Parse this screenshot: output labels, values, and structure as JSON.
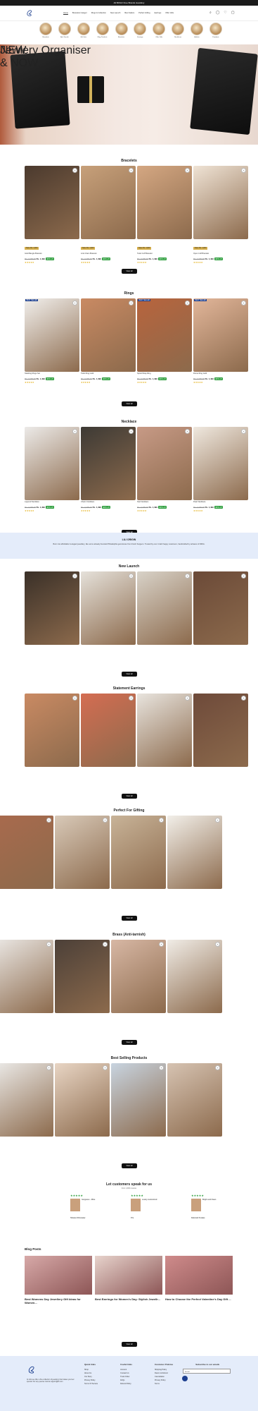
{
  "topbar": {
    "text": "All BOGO Free Brands Jewellery"
  },
  "nav": [
    "Home",
    "Bracelets Categor",
    "Rings & Collection",
    "New Launch",
    "Best Sellers",
    "Perfect Gifting",
    "Earrings",
    "Offer Gifts",
    "Brass (Anti-tarnish)"
  ],
  "header_icons": [
    "search-icon",
    "user-icon",
    "heart-icon",
    "cart-icon"
  ],
  "categories": [
    "Bracelets",
    "Anti-Tarnish",
    "Gift-Sets",
    "Ring Products",
    "Bracelets",
    "Earrings",
    "Offer Gifts",
    "Necklaces",
    "Anklets",
    "Pendants"
  ],
  "hero": {
    "line1": "NEW",
    "line2": "& NOW",
    "sub": "Jewlery Organiser"
  },
  "sections": [
    {
      "title": "Bracelets",
      "products": [
        {
          "save": "Save Rs. 1,000",
          "name": "Gold Bangle Bracelet",
          "mrp": "Rs. 2,499.00",
          "price": "Rs. 1,499",
          "off": "40% off",
          "badge": ""
        },
        {
          "save": "Save Rs. 1,000",
          "name": "Link Chain Bracelet",
          "mrp": "Rs. 2,499.00",
          "price": "Rs. 1,499",
          "off": "40% off",
          "badge": ""
        },
        {
          "save": "Save Rs. 1,000",
          "name": "Twist Cuff Bracelet",
          "mrp": "Rs. 2,499.00",
          "price": "Rs. 1,499",
          "off": "40% off",
          "badge": ""
        },
        {
          "save": "Save Rs. 1,000",
          "name": "Open Cuff Bracelet",
          "mrp": "Rs. 2,499.00",
          "price": "Rs. 1,499",
          "off": "40% off",
          "badge": ""
        }
      ]
    },
    {
      "title": "Rings",
      "products": [
        {
          "save": "",
          "name": "Stacking Rings Set",
          "mrp": "Rs. 2,499.00",
          "price": "Rs. 1,499",
          "off": "40% off",
          "badge": "BEST SELLER"
        },
        {
          "save": "",
          "name": "Twist Ring Gold",
          "mrp": "Rs. 2,499.00",
          "price": "Rs. 1,499",
          "off": "40% off",
          "badge": ""
        },
        {
          "save": "",
          "name": "Spiral Wrap Ring",
          "mrp": "Rs. 2,499.00",
          "price": "Rs. 1,499",
          "off": "40% off",
          "badge": "BEST SELLER"
        },
        {
          "save": "",
          "name": "Dome Ring Gold",
          "mrp": "Rs. 2,499.00",
          "price": "Rs. 1,499",
          "off": "40% off",
          "badge": "BEST SELLER"
        }
      ]
    },
    {
      "title": "Necklace",
      "products": [
        {
          "save": "",
          "name": "Layered Necklace",
          "mrp": "Rs. 2,499.00",
          "price": "Rs. 1,499",
          "off": "40% off",
          "badge": ""
        },
        {
          "save": "",
          "name": "Charm Necklace",
          "mrp": "Rs. 2,499.00",
          "price": "Rs. 1,499",
          "off": "40% off",
          "badge": ""
        },
        {
          "save": "",
          "name": "Star Necklace",
          "mrp": "Rs. 2,499.00",
          "price": "Rs. 1,499",
          "off": "40% off",
          "badge": ""
        },
        {
          "save": "",
          "name": "Pearl Necklace",
          "mrp": "Rs. 2,499.00",
          "price": "Rs. 1,499",
          "off": "40% off",
          "badge": ""
        }
      ]
    }
  ],
  "origin": {
    "title": "LILI ORIGIN",
    "desc": "Born into affordable & elegant jewellery, like we've already founded Philadelphia gemstones from Fresh Surgeon. Trusted by over 1 lakh happy customers, handcrafted by artisans of INDIA."
  },
  "sections2": [
    {
      "title": "New Launch"
    },
    {
      "title": "Statement Earrings"
    },
    {
      "title": "Perfect For Gifting"
    },
    {
      "title": "Brass (Anti-tarnish)"
    },
    {
      "title": "Best Selling Products"
    }
  ],
  "reviews": {
    "title": "Let customers speak for us",
    "sub": "from 1,000 reviews",
    "items": [
      {
        "stars": "★★★★★",
        "title": "Gorgeous - Mine",
        "name": "Shweta Shrivastav"
      },
      {
        "stars": "★★★★★",
        "title": "Lovely customized",
        "name": "P.G."
      },
      {
        "stars": "★★★★★",
        "title": "Bright and Clean",
        "name": "Deborah Perales"
      }
    ]
  },
  "blog": {
    "title": "Blog Posts",
    "posts": [
      {
        "title": "Best Womens Day Jewellery Gift Ideas for Women..."
      },
      {
        "title": "Best Earrings for Women's Day: Stylish Jewellr..."
      },
      {
        "title": "How to Choose the Perfect Valentine's Day Gift ..."
      }
    ]
  },
  "view_all": "View all",
  "footer": {
    "cols": [
      {
        "h": "Quick links",
        "items": [
          "Shop",
          "About Us",
          "Our Story",
          "Privacy Policy",
          "Terms Of Service"
        ]
      },
      {
        "h": "Useful links",
        "items": [
          "Account",
          "Contact Us",
          "Track Order",
          "FAQs",
          "Refund Policy"
        ]
      },
      {
        "h": "Customer Policies",
        "items": [
          "Shipping Policy",
          "Return & Refund",
          "Cancellation",
          "Privacy Policy",
          "Terms"
        ]
      },
      {
        "h": "Subscribe to our emails",
        "items": []
      }
    ],
    "email_placeholder": "Email",
    "about": "At Lilis we offer a fine collection of jewellery that makes you feel special. For any queries mail at support@lili.com"
  },
  "colors": {
    "accent": "#d7b04d",
    "green": "#2a9d3a",
    "navy": "#1c3f8f",
    "light": "#e4ecfa"
  }
}
